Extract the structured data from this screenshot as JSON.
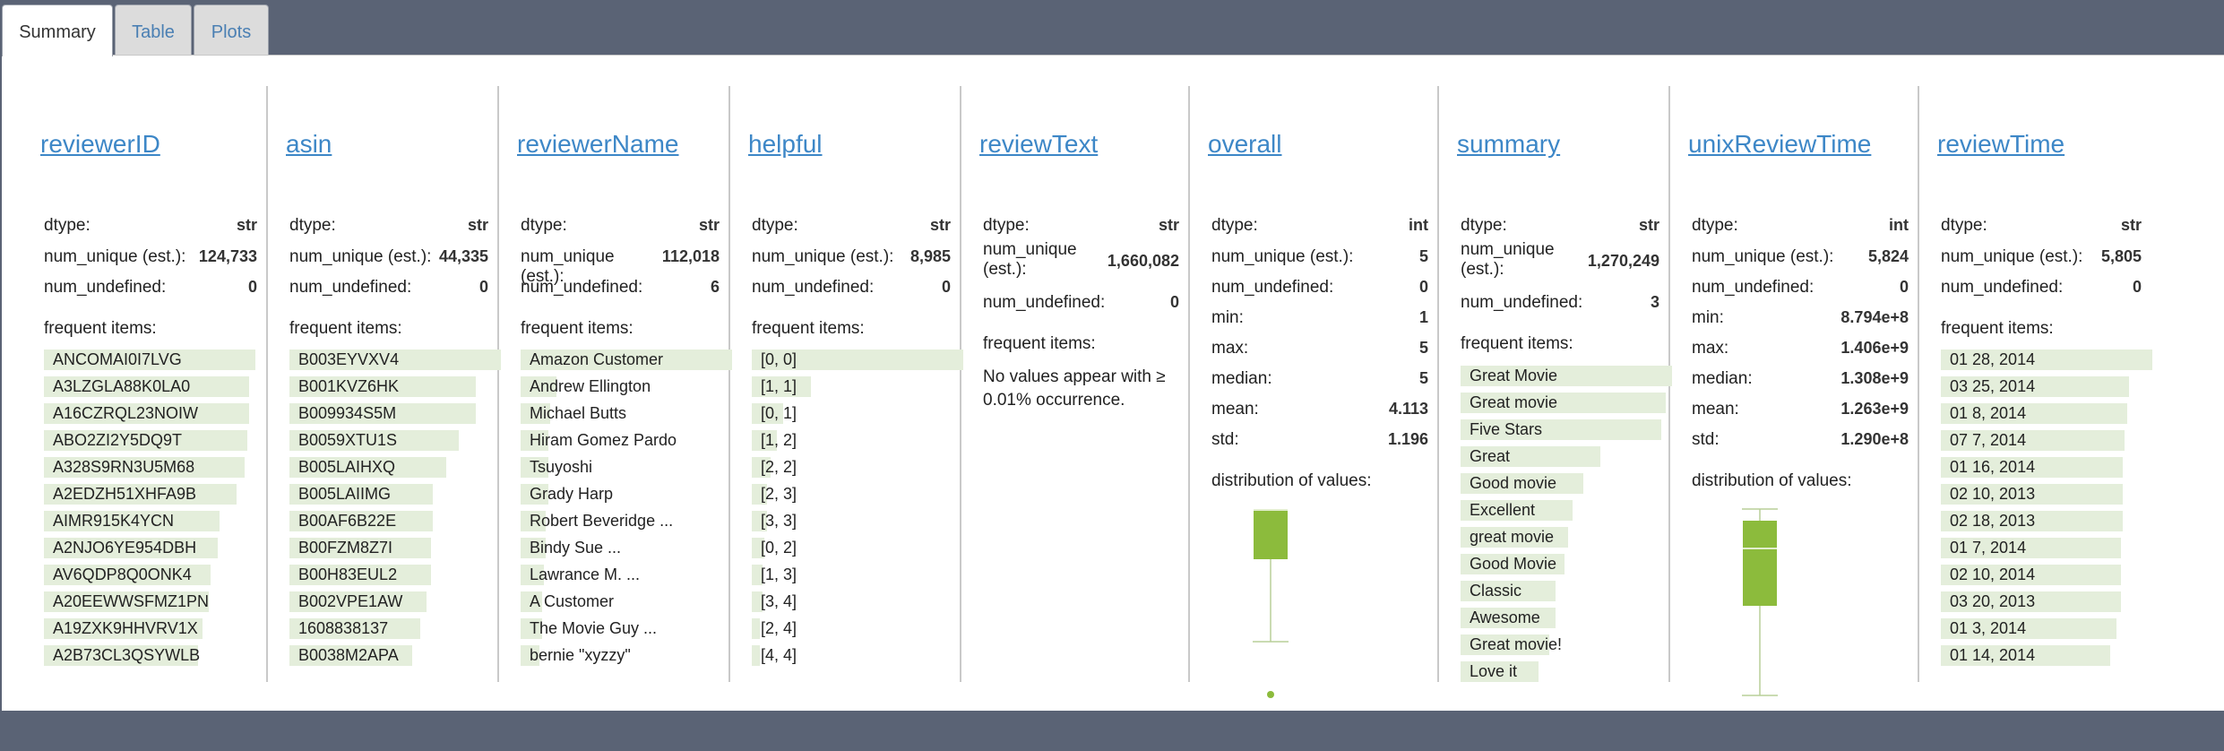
{
  "tabs": [
    "Summary",
    "Table",
    "Plots"
  ],
  "colors": {
    "bar": "#e4eedb",
    "box": "#8cbb3c",
    "link": "#3d87c7"
  },
  "labels": {
    "dtype": "dtype:",
    "num_unique": "num_unique (est.):",
    "num_unique_a": "num_unique",
    "num_unique_b": "(est.):",
    "num_undefined": "num_undefined:",
    "frequent": "frequent items:",
    "min": "min:",
    "max": "max:",
    "median": "median:",
    "mean": "mean:",
    "std": "std:",
    "distribution": "distribution of values:"
  },
  "columns": [
    {
      "name": "reviewerID",
      "dtype": "str",
      "num_unique": "124,733",
      "num_undefined": "0",
      "items": [
        "ANCOMAI0I7LVG",
        "A3LZGLA88K0LA0",
        "A16CZRQL23NOIW",
        "ABO2ZI2Y5DQ9T",
        "A328S9RN3U5M68",
        "A2EDZH51XHFA9B",
        "AIMR915K4YCN",
        "A2NJO6YE954DBH",
        "AV6QDP8Q0ONK4",
        "A20EEWWSFMZ1PN",
        "A19ZXK9HHVRV1X",
        "A2B73CL3QSYWLB"
      ],
      "freq": [
        1.0,
        0.97,
        0.97,
        0.96,
        0.95,
        0.91,
        0.83,
        0.82,
        0.79,
        0.78,
        0.75,
        0.73
      ]
    },
    {
      "name": "asin",
      "dtype": "str",
      "num_unique": "44,335",
      "num_undefined": "0",
      "items": [
        "B003EYVXV4",
        "B001KVZ6HK",
        "B009934S5M",
        "B0059XTU1S",
        "B005LAIHXQ",
        "B005LAIIMG",
        "B00AF6B22E",
        "B00FZM8Z7I",
        "B00H83EUL2",
        "B002VPE1AW",
        "1608838137",
        "B0038M2APA"
      ],
      "freq": [
        1.0,
        0.88,
        0.88,
        0.8,
        0.74,
        0.68,
        0.68,
        0.67,
        0.67,
        0.65,
        0.62,
        0.58
      ]
    },
    {
      "name": "reviewerName",
      "dtype": "str",
      "num_unique": "112,018",
      "num_undefined": "6",
      "items": [
        "Amazon Customer",
        "Andrew Ellington",
        "Michael Butts",
        "Hiram Gomez Pardo",
        "Tsuyoshi",
        "Grady Harp",
        "Robert Beveridge ...",
        "Bindy Sue ...",
        "Lawrance M. ...",
        "A Customer",
        "The Movie Guy ...",
        "bernie \"xyzzy\""
      ],
      "freq": [
        1.0,
        0.17,
        0.14,
        0.13,
        0.13,
        0.13,
        0.12,
        0.12,
        0.11,
        0.1,
        0.1,
        0.09
      ]
    },
    {
      "name": "helpful",
      "dtype": "str",
      "num_unique": "8,985",
      "num_undefined": "0",
      "items": [
        "[0, 0]",
        "[1, 1]",
        "[0, 1]",
        "[1, 2]",
        "[2, 2]",
        "[2, 3]",
        "[3, 3]",
        "[0, 2]",
        "[1, 3]",
        "[3, 4]",
        "[2, 4]",
        "[4, 4]"
      ],
      "freq": [
        1.0,
        0.28,
        0.15,
        0.12,
        0.09,
        0.07,
        0.07,
        0.06,
        0.05,
        0.05,
        0.04,
        0.04
      ]
    },
    {
      "name": "reviewText",
      "dtype": "str",
      "num_unique": "1,660,082",
      "num_undefined": "0",
      "note": "No values appear with ≥ 0.01% occurrence."
    },
    {
      "name": "overall",
      "dtype": "int",
      "num_unique": "5",
      "num_undefined": "0",
      "min": "1",
      "max": "5",
      "median": "5",
      "mean": "4.113",
      "std": "1.196"
    },
    {
      "name": "summary",
      "dtype": "str",
      "num_unique": "1,270,249",
      "num_undefined": "3",
      "items": [
        "Great Movie",
        "Great movie",
        "Five Stars",
        "Great",
        "Good movie",
        "Excellent",
        "great movie",
        "Good Movie",
        "Classic",
        "Awesome",
        "Great movie!",
        "Love it"
      ],
      "freq": [
        1.0,
        0.97,
        0.95,
        0.66,
        0.58,
        0.53,
        0.51,
        0.49,
        0.45,
        0.45,
        0.42,
        0.37
      ]
    },
    {
      "name": "unixReviewTime",
      "dtype": "int",
      "num_unique": "5,824",
      "num_undefined": "0",
      "min": "8.794e+8",
      "max": "1.406e+9",
      "median": "1.308e+9",
      "mean": "1.263e+9",
      "std": "1.290e+8"
    },
    {
      "name": "reviewTime",
      "dtype": "str",
      "num_unique": "5,805",
      "num_undefined": "0",
      "items": [
        "01 28, 2014",
        "03 25, 2014",
        "01 8, 2014",
        "07 7, 2014",
        "01 16, 2014",
        "02 10, 2013",
        "02 18, 2013",
        "01 7, 2014",
        "02 10, 2014",
        "03 20, 2013",
        "01 3, 2014",
        "01 14, 2014"
      ],
      "freq": [
        1.0,
        0.89,
        0.88,
        0.87,
        0.86,
        0.86,
        0.86,
        0.85,
        0.85,
        0.85,
        0.83,
        0.8
      ]
    }
  ]
}
